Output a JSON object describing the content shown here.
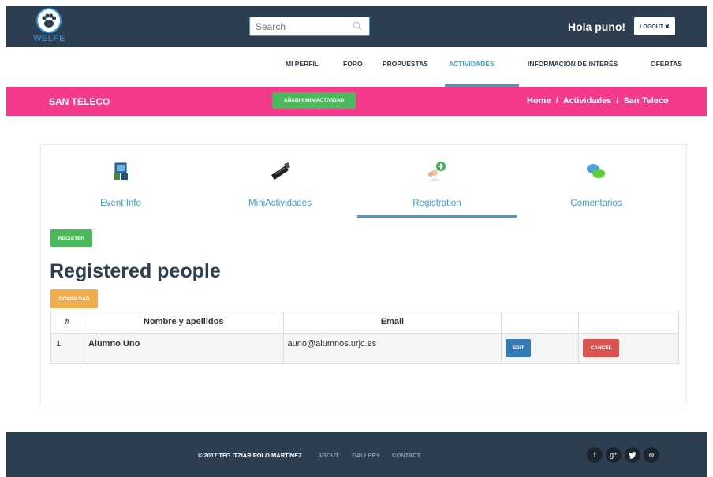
{
  "header": {
    "logo_text": "WELPE",
    "search_placeholder": "Search",
    "greeting": "Hola puno!",
    "logout_label": "LOGOUT ✖"
  },
  "nav": {
    "items": [
      {
        "label": "MI PERFIL"
      },
      {
        "label": "FORO"
      },
      {
        "label": "PROPUESTAS"
      },
      {
        "label": "ACTIVIDADES",
        "active": true
      },
      {
        "label": "INFORMACIÓN DE INTERÉS"
      },
      {
        "label": "OFERTAS"
      }
    ]
  },
  "page_header": {
    "title": "SAN TELECO",
    "add_button": "AÑADIR MINIACTIVIDAD",
    "breadcrumb": [
      "Home",
      "Actividades",
      "San Teleco"
    ],
    "breadcrumb_sep": "/"
  },
  "tabs": [
    {
      "label": "Event Info",
      "icon": "computer-icon"
    },
    {
      "label": "MiniActividades",
      "icon": "clapperboard-icon"
    },
    {
      "label": "Registration",
      "icon": "add-user-icon",
      "active": true
    },
    {
      "label": "Comentarios",
      "icon": "chat-bubbles-icon"
    }
  ],
  "registration": {
    "register_button": "REGISTER",
    "title": "Registered people",
    "download_button": "DOWNLOAD",
    "columns": [
      "#",
      "Nombre y apellidos",
      "Email",
      "",
      ""
    ],
    "rows": [
      {
        "num": "1",
        "name": "Alumno Uno",
        "email": "auno@alumnos.urjc.es",
        "edit": "EDIT",
        "cancel": "CANCEL"
      }
    ]
  },
  "footer": {
    "copyright": "© 2017 TFG ITZIAR POLO MARTÍNEZ",
    "links": [
      "ABOUT",
      "GALLERY",
      "CONTACT"
    ],
    "social": [
      {
        "icon": "facebook-icon",
        "glyph": "f"
      },
      {
        "icon": "google-plus-icon",
        "glyph": "g⁺"
      },
      {
        "icon": "twitter-icon",
        "glyph": "🐦"
      },
      {
        "icon": "dribbble-icon",
        "glyph": "⊛"
      }
    ]
  },
  "colors": {
    "dark": "#2c3e50",
    "accent": "#3a9ed3",
    "pink": "#f63a8b",
    "green": "#4cb85c",
    "orange": "#f0ad4e",
    "blue": "#337ab7",
    "red": "#d9534f"
  }
}
